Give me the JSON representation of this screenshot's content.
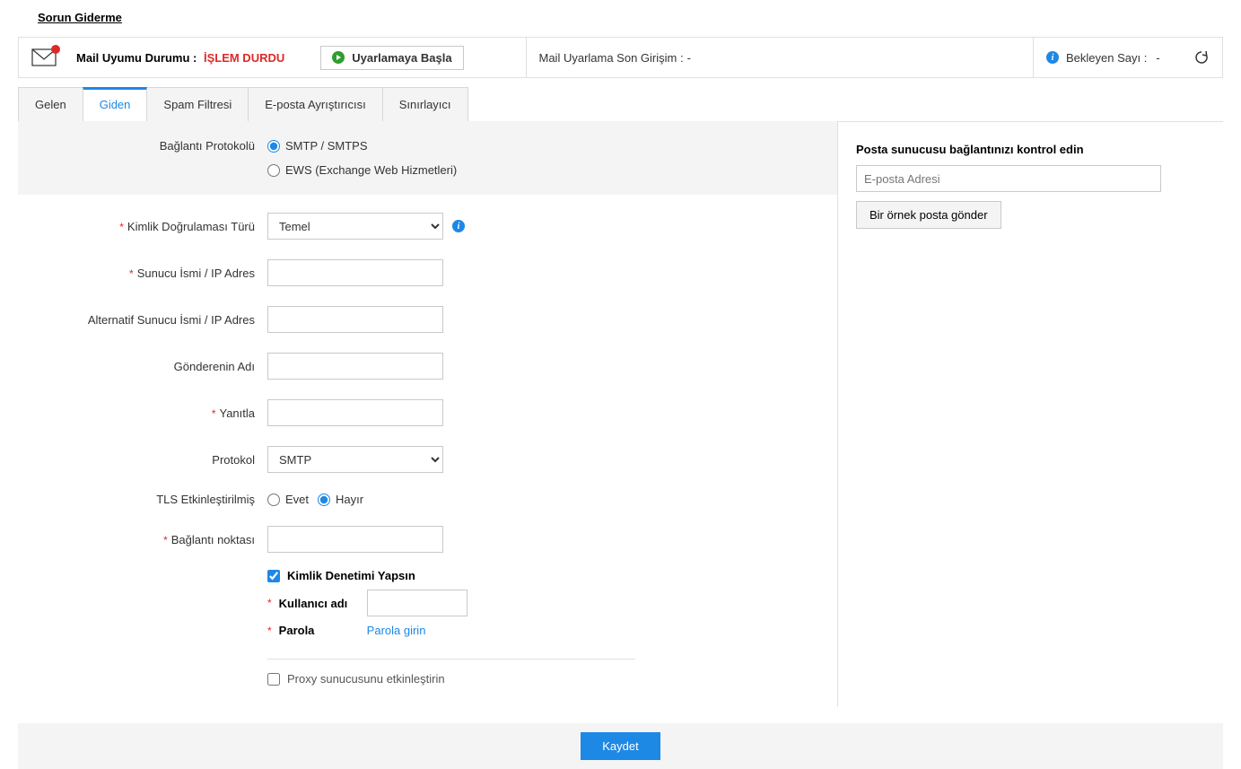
{
  "troubleshoot": "Sorun Giderme",
  "statusbar": {
    "statusLabel": "Mail Uyumu Durumu :",
    "statusValue": "İŞLEM DURDU",
    "startBtn": "Uyarlamaya Başla",
    "lastAttemptLabel": "Mail Uyarlama Son Girişim :",
    "lastAttemptValue": "-",
    "pendingLabel": "Bekleyen Sayı :",
    "pendingValue": "-"
  },
  "tabs": {
    "incoming": "Gelen",
    "outgoing": "Giden",
    "spam": "Spam Filtresi",
    "parser": "E-posta Ayrıştırıcısı",
    "limiter": "Sınırlayıcı"
  },
  "form": {
    "connProtocolLabel": "Bağlantı Protokolü",
    "optSmtp": "SMTP / SMTPS",
    "optEws": "EWS (Exchange Web Hizmetleri)",
    "authTypeLabel": "Kimlik Doğrulaması Türü",
    "authTypeValue": "Temel",
    "serverLabel": "Sunucu İsmi / IP Adres",
    "altServerLabel": "Alternatif Sunucu İsmi / IP Adres",
    "senderLabel": "Gönderenin Adı",
    "replyLabel": "Yanıtla",
    "protocolLabel": "Protokol",
    "protocolValue": "SMTP",
    "tlsLabel": "TLS Etkinleştirilmiş",
    "yes": "Evet",
    "no": "Hayır",
    "portLabel": "Bağlantı noktası",
    "authCheck": "Kimlik Denetimi Yapsın",
    "userLabel": "Kullanıcı adı",
    "passLabel": "Parola",
    "passLink": "Parola girin",
    "proxyLabel": "Proxy sunucusunu etkinleştirin"
  },
  "side": {
    "title": "Posta sunucusu bağlantınızı kontrol edin",
    "emailPlaceholder": "E-posta Adresi",
    "sendBtn": "Bir örnek posta gönder"
  },
  "footer": {
    "save": "Kaydet"
  }
}
